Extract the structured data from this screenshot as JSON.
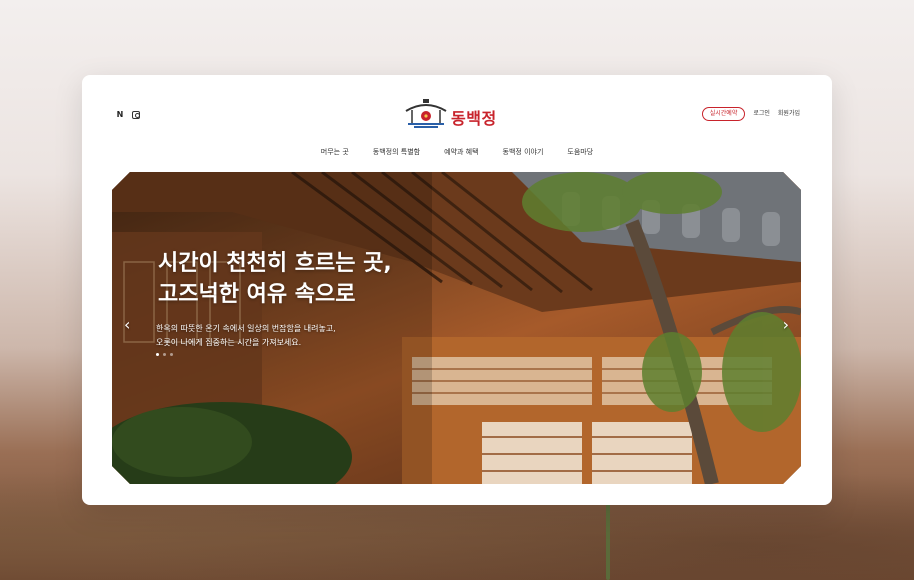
{
  "header": {
    "social": [
      "naver-icon",
      "instagram-icon"
    ],
    "logo_text": "동백정",
    "reserve_label": "실시간예약",
    "login_label": "로그인",
    "signup_label": "회원가입"
  },
  "nav": {
    "items": [
      {
        "label": "머무는 곳"
      },
      {
        "label": "동백정의 특별함"
      },
      {
        "label": "예약과 혜택"
      },
      {
        "label": "동백정 이야기"
      },
      {
        "label": "도움마당"
      }
    ]
  },
  "hero": {
    "title_line1": "시간이 천천히 흐르는 곳,",
    "title_line2": "고즈넉한 여유 속으로",
    "desc_line1": "한옥의 따뜻한 온기 속에서 일상의 번잡함을 내려놓고,",
    "desc_line2": "오롯이 나에게 집중하는 시간을 가져보세요.",
    "prev_icon": "chevron-left-icon",
    "next_icon": "chevron-right-icon",
    "slides": 3,
    "active_slide": 1
  },
  "colors": {
    "accent": "#c8232b",
    "logo_blue": "#2a5fa8",
    "wood": "#a65a2a"
  }
}
